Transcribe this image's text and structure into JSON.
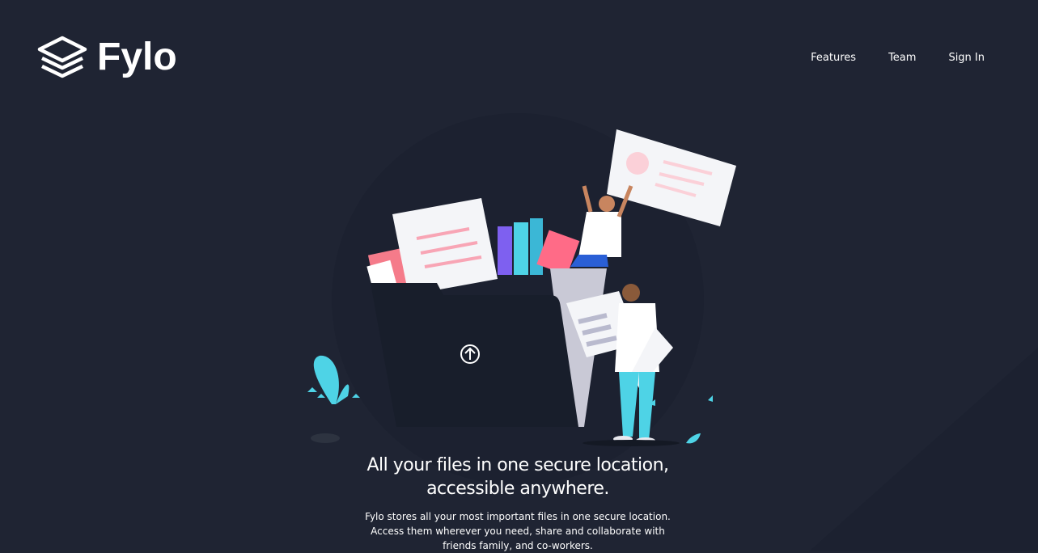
{
  "brand": {
    "name": "Fylo",
    "logo_icon": "stacked-layers-icon"
  },
  "nav": {
    "items": [
      {
        "label": "Features"
      },
      {
        "label": "Team"
      },
      {
        "label": "Sign In"
      }
    ]
  },
  "hero": {
    "title_line1": "All your files in one secure location,",
    "title_line2": "accessible anywhere.",
    "desc_line1": "Fylo stores all your most important files in one secure location.",
    "desc_line2": "Access them wherever you need, share and collaborate with",
    "desc_line3": "friends family, and co-workers.",
    "illustration_icon": "upload-arrow-icon"
  },
  "colors": {
    "background": "#1f2433",
    "folder": "#181e2b",
    "accent_cyan": "#4ed3e6",
    "accent_pink": "#f8a5b5",
    "text": "#ffffff"
  }
}
